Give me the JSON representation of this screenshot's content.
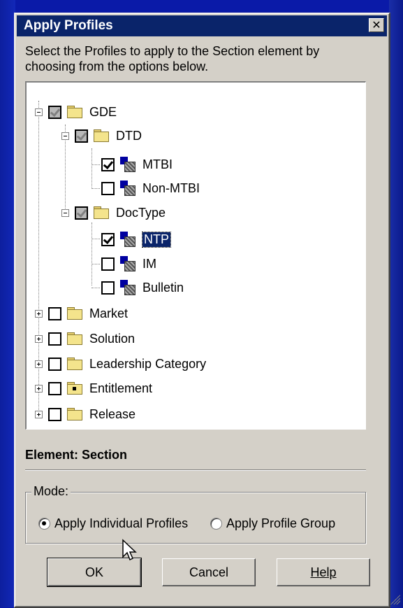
{
  "dialog": {
    "title": "Apply Profiles",
    "close_glyph": "✕",
    "instructions": "Select the Profiles to apply to the Section element by choosing from the options below."
  },
  "tree": [
    {
      "label": "GDE",
      "icon": "folder-icon",
      "state": "partial",
      "expander": "minus"
    },
    {
      "label": "DTD",
      "icon": "folder-icon",
      "state": "partial",
      "expander": "minus"
    },
    {
      "label": "MTBI",
      "icon": "profile-icon",
      "state": "checked"
    },
    {
      "label": "Non-MTBI",
      "icon": "profile-icon",
      "state": "unchecked"
    },
    {
      "label": "DocType",
      "icon": "folder-icon",
      "state": "partial",
      "expander": "minus"
    },
    {
      "label": "NTP",
      "icon": "profile-icon",
      "state": "checked",
      "selected": true
    },
    {
      "label": "IM",
      "icon": "profile-icon",
      "state": "unchecked"
    },
    {
      "label": "Bulletin",
      "icon": "profile-icon",
      "state": "unchecked"
    },
    {
      "label": "Market",
      "icon": "folder-icon",
      "state": "unchecked",
      "expander": "plus"
    },
    {
      "label": "Solution",
      "icon": "folder-icon",
      "state": "unchecked",
      "expander": "plus"
    },
    {
      "label": "Leadership Category",
      "icon": "folder-icon",
      "state": "unchecked",
      "expander": "plus"
    },
    {
      "label": "Entitlement",
      "icon": "locked-folder-icon",
      "state": "unchecked",
      "expander": "plus"
    },
    {
      "label": "Release",
      "icon": "folder-icon",
      "state": "unchecked",
      "expander": "plus"
    }
  ],
  "element_label": "Element: Section",
  "mode": {
    "legend": "Mode:",
    "options": [
      {
        "label": "Apply Individual Profiles",
        "selected": true
      },
      {
        "label": "Apply Profile Group",
        "selected": false
      }
    ]
  },
  "buttons": {
    "ok": "OK",
    "cancel": "Cancel",
    "help": "Help"
  },
  "colors": {
    "title_bar": "#0a246a",
    "dialog_face": "#d4d0c8",
    "selection": "#0a246a"
  }
}
